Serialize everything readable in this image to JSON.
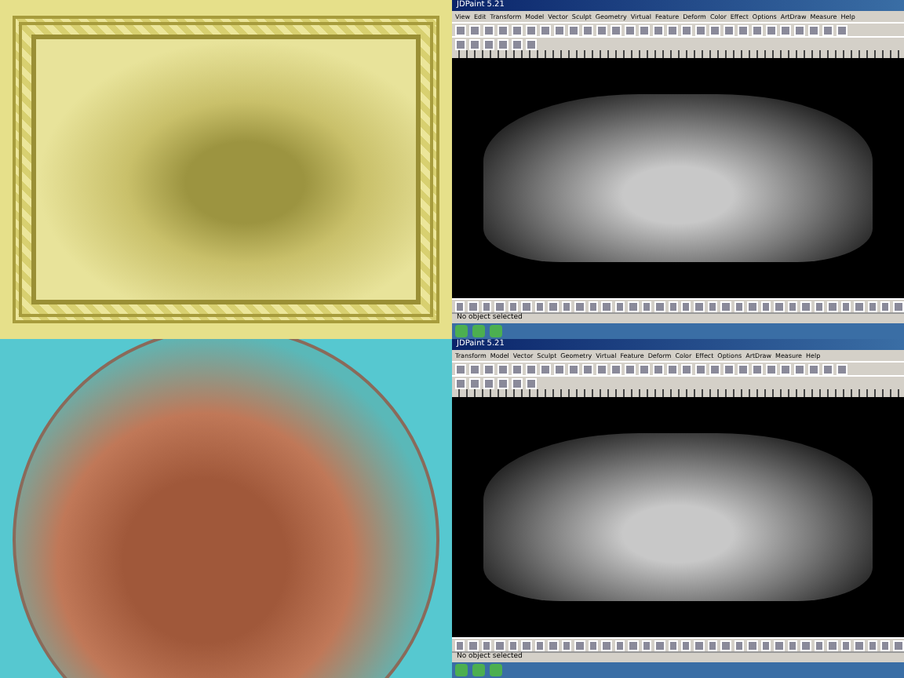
{
  "renders": [
    {
      "kind": "panel"
    },
    {
      "kind": "roundel"
    }
  ],
  "windows": [
    {
      "title": "JDPaint 5.21",
      "menus": [
        "View",
        "Edit",
        "Transform",
        "Model",
        "Vector",
        "Sculpt",
        "Geometry",
        "Virtual",
        "Feature",
        "Deform",
        "Color",
        "Effect",
        "Options",
        "ArtDraw",
        "Measure",
        "Help"
      ],
      "status": "No object selected"
    },
    {
      "title": "JDPaint 5.21",
      "menus": [
        "Transform",
        "Model",
        "Vector",
        "Sculpt",
        "Geometry",
        "Virtual",
        "Feature",
        "Deform",
        "Color",
        "Effect",
        "Options",
        "ArtDraw",
        "Measure",
        "Help"
      ],
      "status": "No object selected"
    }
  ]
}
